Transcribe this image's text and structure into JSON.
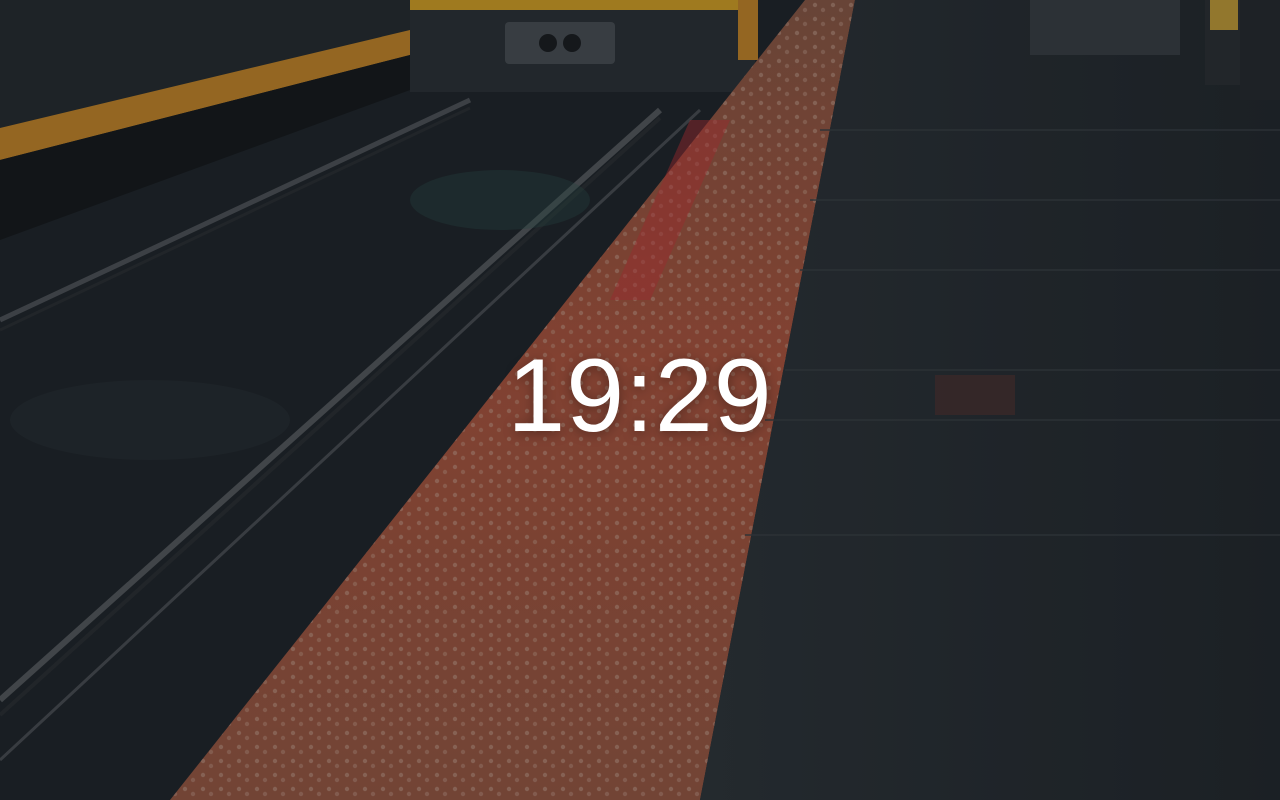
{
  "lock_screen": {
    "time": "19:29"
  },
  "wallpaper": {
    "subject": "rail-platform-photo",
    "colors": {
      "track_bed": "#1f262b",
      "platform": "#2a3136",
      "tactile_strip": "#b5603f",
      "safety_edge": "#c98a2a",
      "train_body": "#2c3338",
      "train_trim": "#d9a626"
    }
  }
}
